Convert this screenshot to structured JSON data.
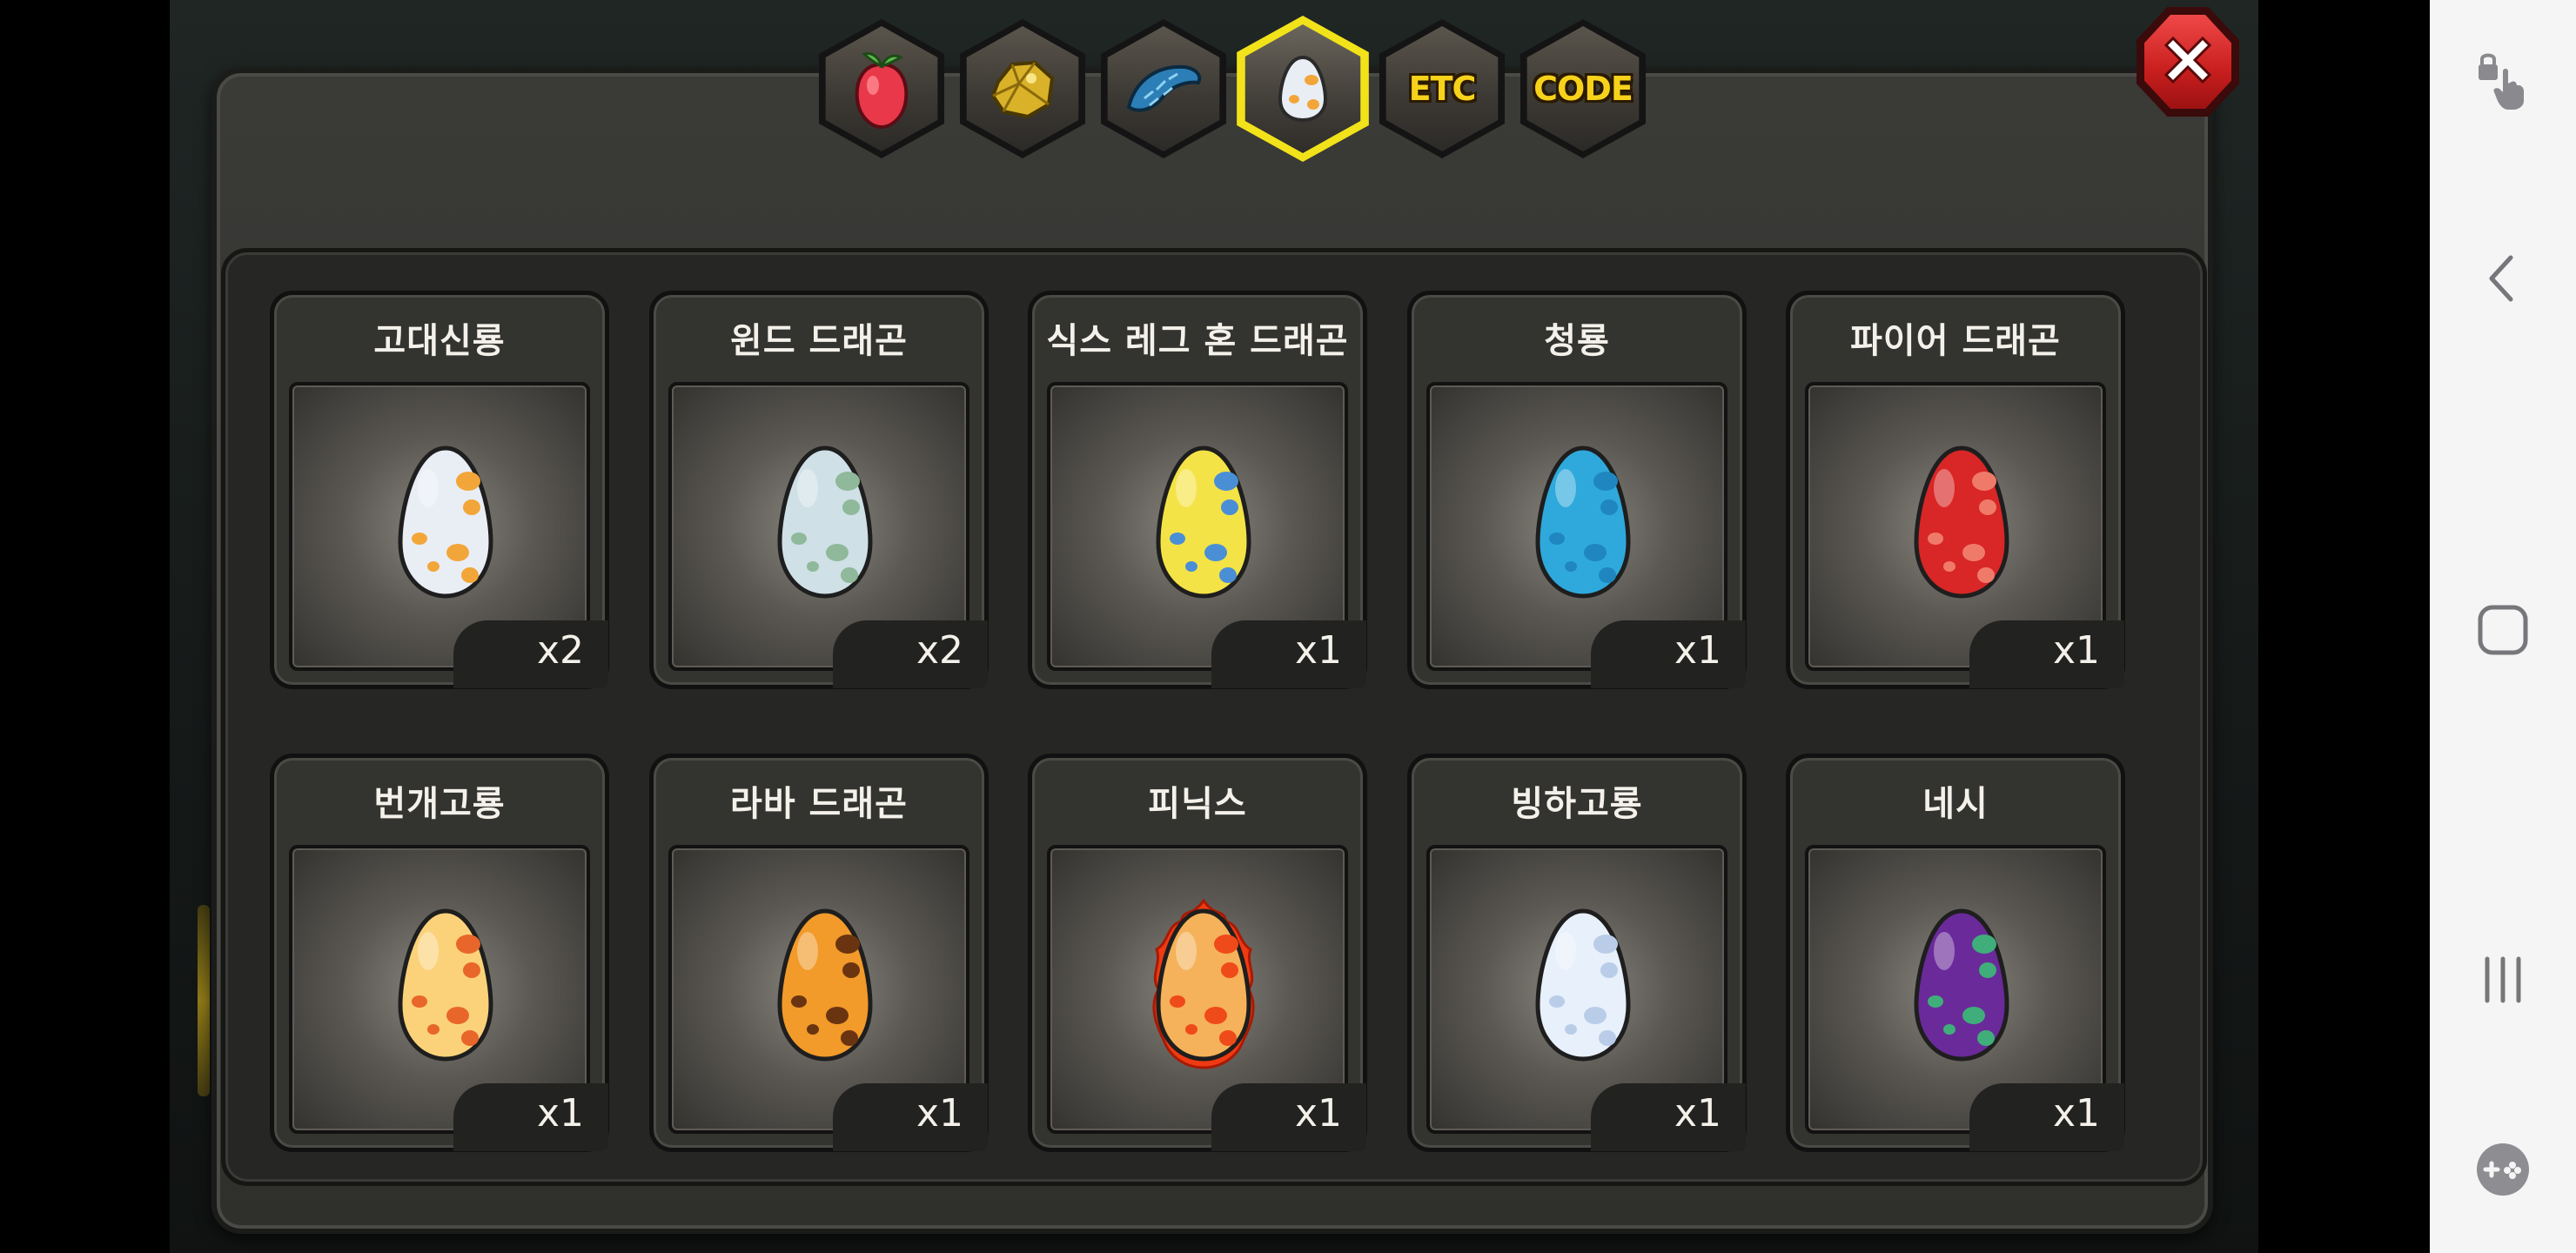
{
  "tabs": [
    {
      "id": "fruit",
      "label": "",
      "icon": "fruit-icon"
    },
    {
      "id": "gold",
      "label": "",
      "icon": "gold-nugget-icon"
    },
    {
      "id": "scale",
      "label": "",
      "icon": "dragon-scale-icon"
    },
    {
      "id": "egg",
      "label": "",
      "icon": "egg-icon",
      "active": true
    },
    {
      "id": "etc",
      "label": "ETC"
    },
    {
      "id": "code",
      "label": "CODE"
    }
  ],
  "items": [
    {
      "name": "고대신룡",
      "count": "x2",
      "egg_color": "#e9eef5",
      "spot_color": "#f2a63a"
    },
    {
      "name": "윈드 드래곤",
      "count": "x2",
      "egg_color": "#cfe0e6",
      "spot_color": "#8fb99a"
    },
    {
      "name": "식스 레그 혼 드래곤",
      "count": "x1",
      "egg_color": "#f4e347",
      "spot_color": "#4a8fd6"
    },
    {
      "name": "청룡",
      "count": "x1",
      "egg_color": "#2fa9dc",
      "spot_color": "#1f86bf"
    },
    {
      "name": "파이어 드래곤",
      "count": "x1",
      "egg_color": "#d92626",
      "spot_color": "#f07a6a"
    },
    {
      "name": "번개고룡",
      "count": "x1",
      "egg_color": "#fbd27a",
      "spot_color": "#e8662a"
    },
    {
      "name": "라바 드래곤",
      "count": "x1",
      "egg_color": "#f29a2a",
      "spot_color": "#6b3410"
    },
    {
      "name": "피닉스",
      "count": "x1",
      "egg_color": "#f5b25a",
      "spot_color": "#ef4a1a"
    },
    {
      "name": "빙하고룡",
      "count": "x1",
      "egg_color": "#e8f0fb",
      "spot_color": "#b9cde8"
    },
    {
      "name": "네시",
      "count": "x1",
      "egg_color": "#6a2a9a",
      "spot_color": "#3fae7a"
    }
  ],
  "nav_bar": {
    "buttons": [
      {
        "id": "touch-lock",
        "icon": "touch-lock-icon"
      },
      {
        "id": "back",
        "icon": "back-icon"
      },
      {
        "id": "home",
        "icon": "home-icon"
      },
      {
        "id": "recents",
        "icon": "recents-icon"
      },
      {
        "id": "game-tools",
        "icon": "game-tools-icon"
      }
    ]
  },
  "colors": {
    "tab_active_border": "#f2e21a",
    "tab_text": "#f7d21b",
    "close_button": "#d42424"
  }
}
